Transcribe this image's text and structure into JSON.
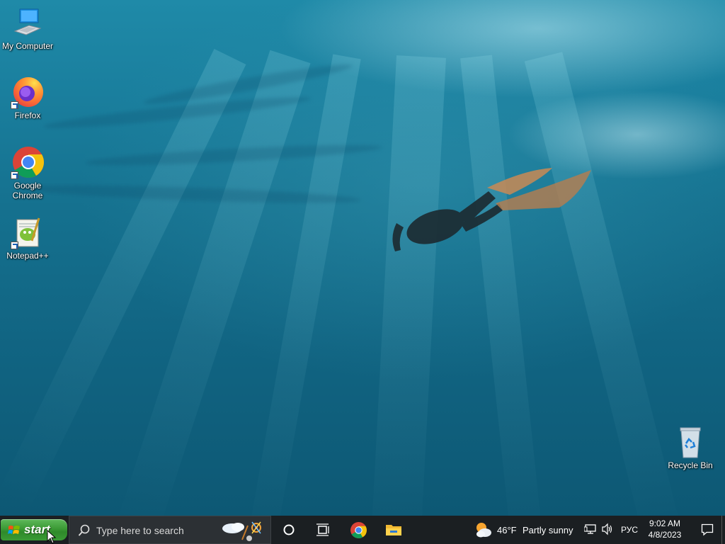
{
  "desktop": {
    "icons": [
      {
        "label": "My Computer"
      },
      {
        "label": "Firefox"
      },
      {
        "label": "Google Chrome"
      },
      {
        "label": "Notepad++"
      },
      {
        "label": "Recycle Bin"
      }
    ]
  },
  "taskbar": {
    "start_label": "start",
    "search_placeholder": "Type here to search",
    "pinned": [
      {
        "name": "cortana-icon"
      },
      {
        "name": "task-view-icon"
      },
      {
        "name": "chrome-icon"
      },
      {
        "name": "file-explorer-icon"
      }
    ],
    "weather": {
      "temp": "46°F",
      "condition": "Partly sunny"
    },
    "language": "РУС",
    "clock": {
      "time": "9:02 AM",
      "date": "4/8/2023"
    }
  }
}
